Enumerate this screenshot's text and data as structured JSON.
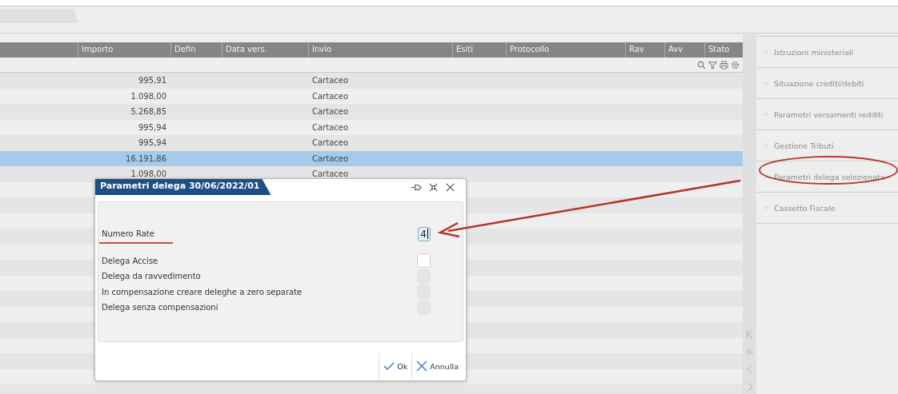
{
  "table": {
    "columns": [
      "",
      "Importo",
      "Defin",
      "Data vers.",
      "Invio",
      "Esiti",
      "Protocollo",
      "Rav",
      "Avv",
      "Stato"
    ],
    "rows": [
      {
        "importo": "995,91",
        "invio": "Cartaceo",
        "selected": false
      },
      {
        "importo": "1.098,00",
        "invio": "Cartaceo",
        "selected": false
      },
      {
        "importo": "5.268,85",
        "invio": "Cartaceo",
        "selected": false
      },
      {
        "importo": "995,94",
        "invio": "Cartaceo",
        "selected": false
      },
      {
        "importo": "995,94",
        "invio": "Cartaceo",
        "selected": false
      },
      {
        "importo": "16.191,86",
        "invio": "Cartaceo",
        "selected": true
      },
      {
        "importo": "1.098,00",
        "invio": "Cartaceo",
        "selected": false
      }
    ]
  },
  "sidebar": {
    "items": [
      "Istruzioni ministeriali",
      "Situazione crediti/debiti",
      "Parametri versamenti redditi",
      "Gestione Tributi",
      "Parametri delega selezionata",
      "Cassetto Fiscale"
    ]
  },
  "dialog": {
    "title": "Parametri delega 30/06/2022/01",
    "field": {
      "label": "Numero Rate",
      "value": "4"
    },
    "options": [
      {
        "label": "Delega Accise",
        "checked": false,
        "disabled": false
      },
      {
        "label": "Delega da ravvedimento",
        "checked": false,
        "disabled": true
      },
      {
        "label": "In compensazione creare deleghe a zero separate",
        "checked": false,
        "disabled": true
      },
      {
        "label": "Delega senza compensazioni",
        "checked": false,
        "disabled": true
      }
    ],
    "buttons": [
      {
        "kind": "ok",
        "label": "Ok"
      },
      {
        "kind": "cancel",
        "label": "Annulla"
      }
    ]
  }
}
